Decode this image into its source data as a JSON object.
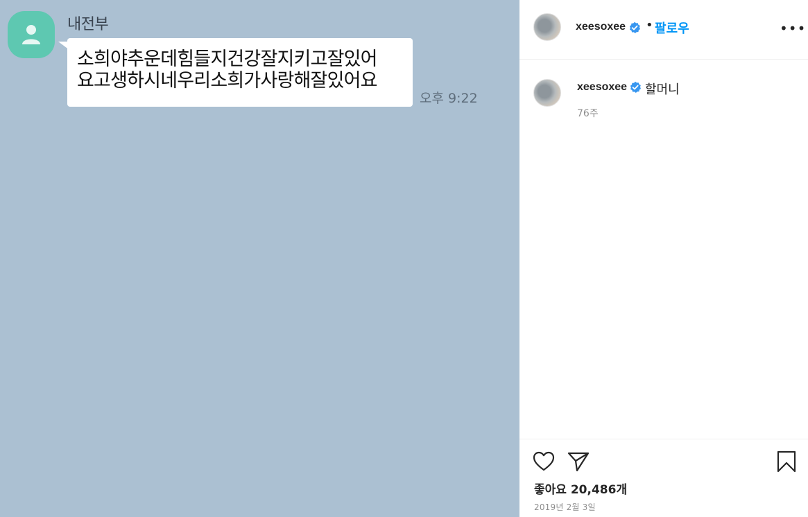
{
  "chat": {
    "sender_name": "내전부",
    "message": "소희야추운데힘들지건강잘지키고잘있어\n요고생하시네우리소희가사랑해잘있어요",
    "time": "오후 9:22",
    "avatar_color": "#5ec8b1",
    "background_color": "#abc0d2"
  },
  "post": {
    "header": {
      "username": "xeesoxee",
      "verified": true,
      "separator": "•",
      "follow_label": "팔로우",
      "more_label": "•••"
    },
    "caption": {
      "username": "xeesoxee",
      "verified": true,
      "text": "할머니",
      "age": "76주"
    },
    "actions": {
      "like_icon": "heart-icon",
      "share_icon": "paper-plane-icon",
      "save_icon": "bookmark-icon"
    },
    "likes_text": "좋아요 20,486개",
    "date_text": "2019년 2월 3일",
    "accent_color": "#0095f6",
    "verified_color": "#3897f0"
  }
}
